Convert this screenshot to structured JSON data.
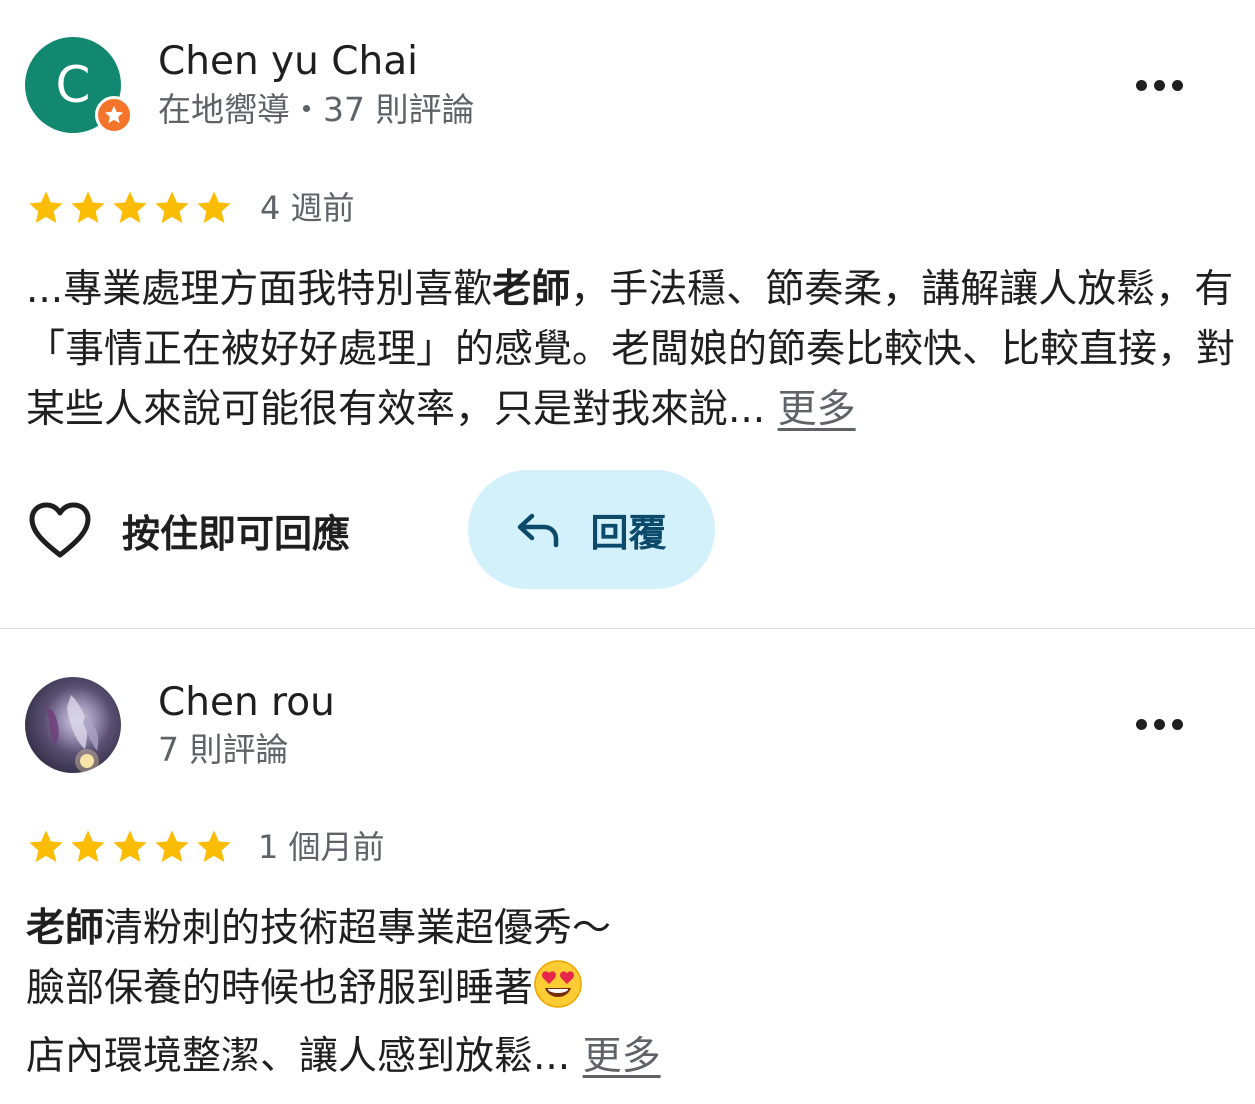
{
  "reviews": [
    {
      "reviewer_name": "Chen yu Chai",
      "avatar_letter": "C",
      "reviewer_meta": "在地嚮導・37 則評論",
      "rating": 5,
      "date": "4 週前",
      "text_prefix": "...專業處理方面我特別喜歡",
      "text_highlight": "老師",
      "text_rest": "，手法穩、節奏柔，講解讓人放鬆，有「事情正在被好好處理」的感覺。老闆娘的節奏比較快、比較直接，對某些人來說可能很有效率，只是對我來說...",
      "more_label": "更多",
      "like_label": "按住即可回應",
      "reply_label": "回覆"
    },
    {
      "reviewer_name": "Chen rou",
      "reviewer_meta": "7 則評論",
      "rating": 5,
      "date": "1 個月前",
      "line1_highlight": "老師",
      "line1_rest": "清粉刺的技術超專業超優秀～",
      "line2": "臉部保養的時候也舒服到睡著",
      "line3": "店內環境整潔、讓人感到放鬆...",
      "more_label": "更多"
    }
  ],
  "colors": {
    "avatar_bg": "#138870",
    "guide_badge": "#f4742b",
    "star": "#fbbc04",
    "reply_bg": "#d3f1fb",
    "reply_text": "#0b4a6b",
    "secondary_text": "#5f6368"
  },
  "icons": {
    "menu": "more-horizontal-icon",
    "like": "heart-outline-icon",
    "reply": "reply-arrow-icon",
    "badge": "local-guide-star-icon",
    "emoji": "heart-eyes-emoji"
  }
}
